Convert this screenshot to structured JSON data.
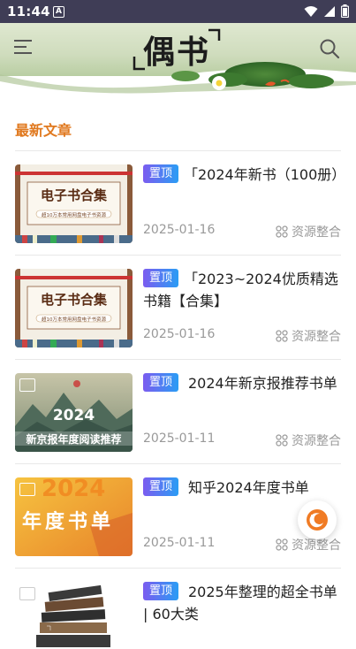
{
  "status_bar": {
    "time": "11:44",
    "notif": "A"
  },
  "header": {
    "logo": "偶书",
    "menu_icon": "menu-icon",
    "search_icon": "search-icon"
  },
  "section": {
    "title": "最新文章"
  },
  "articles": [
    {
      "title": "「2024年新书（100册）",
      "pinned": "置顶",
      "date": "2025-01-16",
      "category": "资源整合",
      "thumb_title": "电子书合集",
      "thumb_sub": "超10万本常用网盘电子书资源"
    },
    {
      "title": "「2023~2024优质精选书籍【合集】",
      "pinned": "置顶",
      "date": "2025-01-16",
      "category": "资源整合",
      "thumb_title": "电子书合集",
      "thumb_sub": "超10万本常用网盘电子书资源"
    },
    {
      "title": "2024年新京报推荐书单",
      "pinned": "置顶",
      "date": "2025-01-11",
      "category": "资源整合",
      "thumb_year": "2024",
      "thumb_caption": "新京报年度阅读推荐"
    },
    {
      "title": "知乎2024年度书单",
      "pinned": "置顶",
      "date": "2025-01-11",
      "category": "资源整合",
      "thumb_year": "2024",
      "thumb_caption": "年度书单"
    },
    {
      "title": "2025年整理的超全书单 | 60大类",
      "pinned": "置顶",
      "date": "",
      "category": ""
    }
  ]
}
